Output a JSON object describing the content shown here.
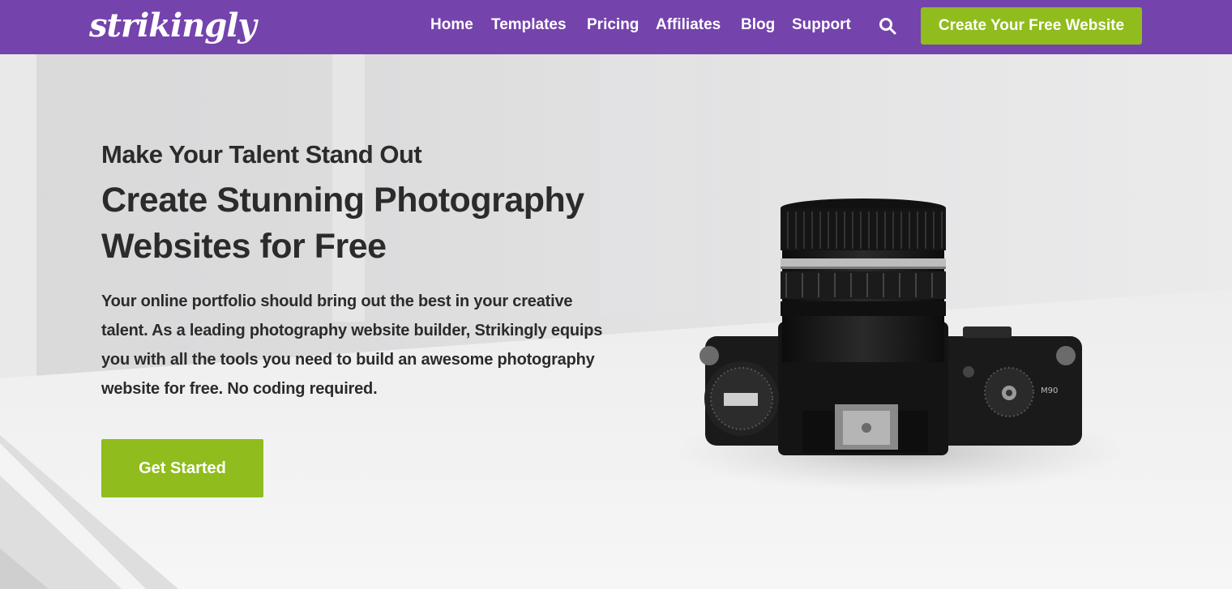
{
  "brand": {
    "logo_text": "strikingly"
  },
  "nav": {
    "links": [
      "Home",
      "Templates",
      "Pricing",
      "Affiliates",
      "Blog",
      "Support"
    ],
    "search_icon": "search-icon",
    "cta_label": "Create Your Free Website"
  },
  "hero": {
    "subtitle": "Make Your Talent Stand Out",
    "title": "Create Stunning Photography Websites for Free",
    "description": "Your online portfolio should bring out the best in your creative talent. As a leading photography website builder, Strikingly equips you with all the tools you need to build an awesome photography website for free. No coding required.",
    "cta_label": "Get Started",
    "camera_label": "M90"
  },
  "colors": {
    "nav_bg": "#7443ac",
    "accent_green": "#90bc1d",
    "text_dark": "#2b2b2b"
  }
}
